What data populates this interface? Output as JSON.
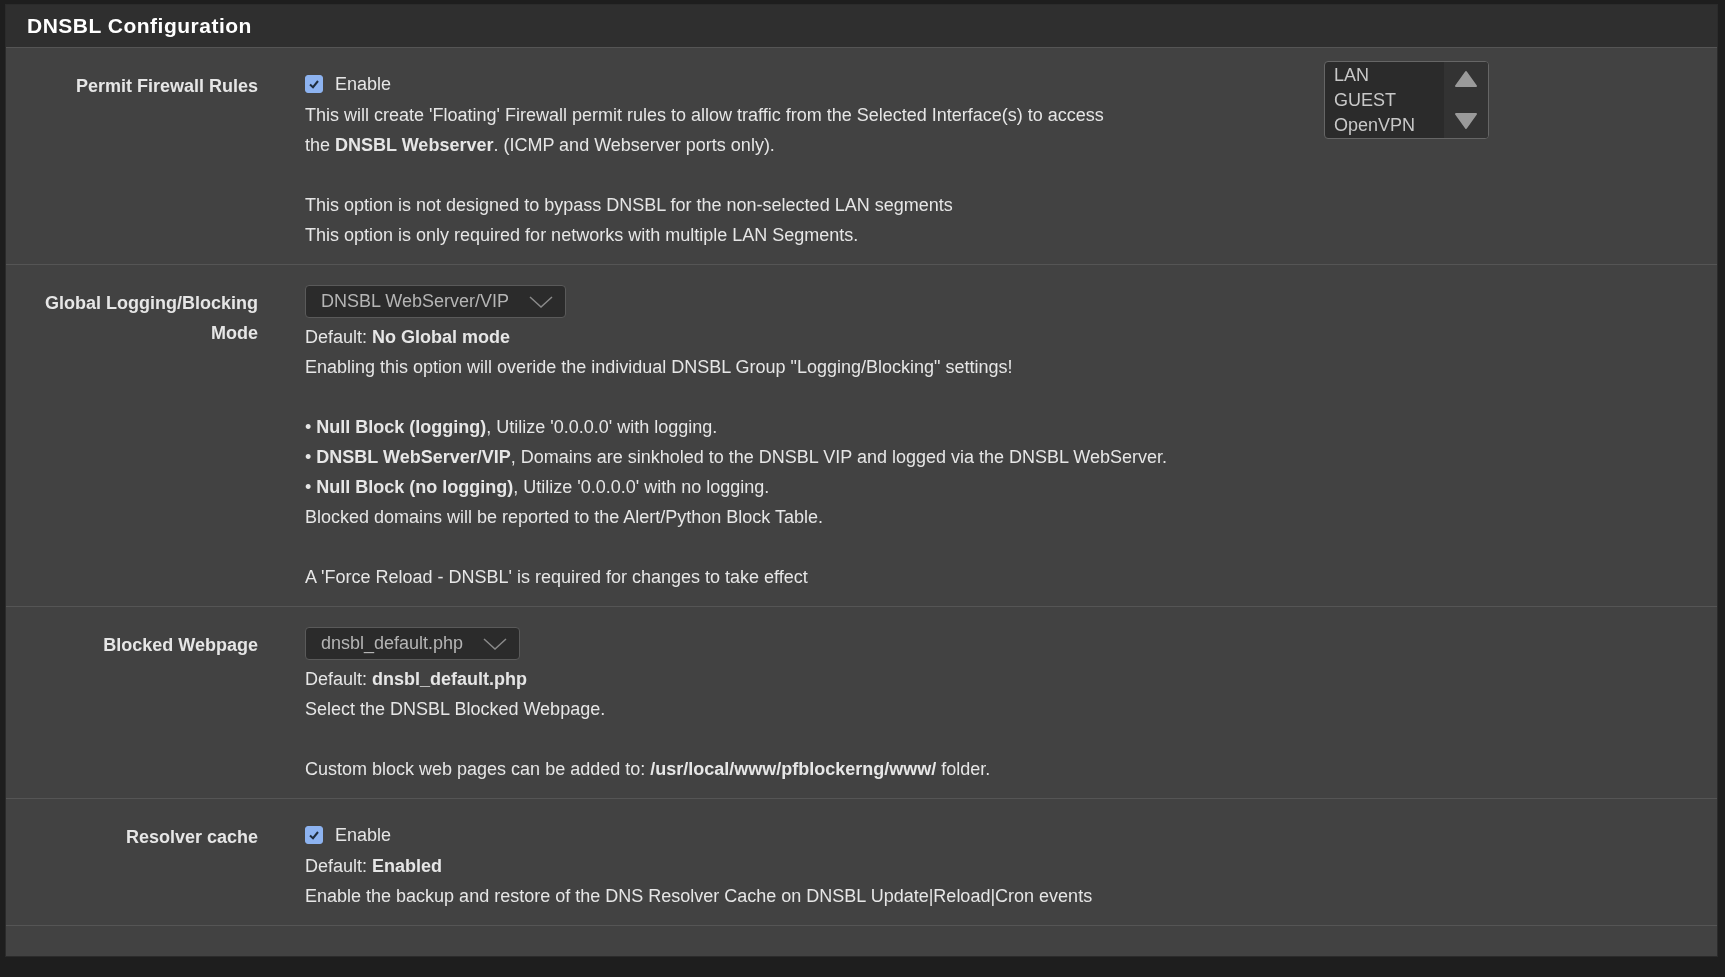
{
  "panel": {
    "title": "DNSBL Configuration"
  },
  "rows": [
    {
      "label": "Permit Firewall Rules",
      "control": {
        "kind": "checkbox",
        "label": "Enable",
        "checked": true
      },
      "listbox": {
        "items": [
          {
            "label": "LAN",
            "selected": false
          },
          {
            "label": "GUEST",
            "selected": false
          },
          {
            "label": "OpenVPN",
            "selected": false
          }
        ]
      },
      "help": [
        [
          "This will create 'Floating' Firewall permit rules to allow traffic from the Selected Interface(s) to access",
          "the **DNSBL Webserver**. (ICMP and Webserver ports only)."
        ],
        [
          "This option is not designed to bypass DNSBL for the non-selected LAN segments",
          "This option is only required for networks with multiple LAN Segments."
        ]
      ]
    },
    {
      "label": "Global Logging/Blocking Mode",
      "control": {
        "kind": "select",
        "value": "DNSBL WebServer/VIP"
      },
      "help": [
        [
          "Default: **No Global mode**",
          "Enabling this option will overide the individual DNSBL Group \"Logging/Blocking\" settings!"
        ],
        [
          "• **Null Block (logging)**, Utilize '0.0.0.0' with logging.",
          "• **DNSBL WebServer/VIP**, Domains are sinkholed to the DNSBL VIP and logged via the DNSBL WebServer.",
          "• **Null Block (no logging)**, Utilize '0.0.0.0' with no logging.",
          "Blocked domains will be reported to the Alert/Python Block Table."
        ],
        [
          "A 'Force Reload - DNSBL' is required for changes to take effect"
        ]
      ]
    },
    {
      "label": "Blocked Webpage",
      "control": {
        "kind": "select",
        "value": "dnsbl_default.php"
      },
      "help": [
        [
          "Default: **dnsbl_default.php**",
          "Select the DNSBL Blocked Webpage."
        ],
        [
          "Custom block web pages can be added to: **/usr/local/www/pfblockerng/www/** folder."
        ]
      ]
    },
    {
      "label": "Resolver cache",
      "control": {
        "kind": "checkbox",
        "label": "Enable",
        "checked": true
      },
      "help": [
        [
          "Default: **Enabled**",
          "Enable the backup and restore of the DNS Resolver Cache on DNSBL Update|Reload|Cron events"
        ]
      ]
    }
  ]
}
